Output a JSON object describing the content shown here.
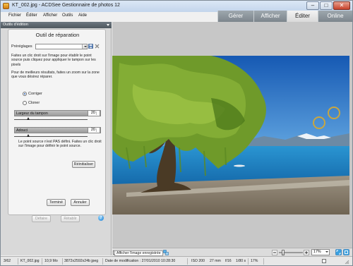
{
  "window": {
    "title": "KT_002.jpg - ACDSee Gestionnaire de photos 12",
    "min_glyph": "–",
    "max_glyph": "□",
    "close_glyph": "✕"
  },
  "menu": [
    "Fichier",
    "Éditer",
    "Afficher",
    "Outils",
    "Aide"
  ],
  "mode_tabs": {
    "manage": "Gérer",
    "view": "Afficher",
    "edit": "Éditer",
    "online": "Online"
  },
  "panel": {
    "header": "Outils d'édition",
    "tool_title": "Outil de réparation",
    "presets_label": "Préréglages",
    "presets_value": "",
    "intro_text": "Faites un clic droit sur l'image pour établir le point source puis cliquez pour appliquer le tampon sur les pixels",
    "zoom_text": "Pour de meilleurs résultats, faites un zoom sur la zone que vous désirez réparer.",
    "mode_correct": "Corriger",
    "mode_clone": "Cloner",
    "selected_mode": "Corriger",
    "brush_width_label": "Largeur du tampon",
    "brush_width_value": "20",
    "brush_width_level": 0.2,
    "softness_label": "Adouci",
    "softness_value": "20",
    "softness_level": 0.2,
    "source_note": "Le point source n'est PAS défini. Faites un clic droit sur l'image pour définir le point source.",
    "reset_button": "Réinitialiser",
    "done_button": "Terminé",
    "cancel_button": "Annuler",
    "undo_button": "Défaire",
    "redo_button": "Rétablir",
    "help_glyph": "?"
  },
  "viewbar": {
    "show_saved_label": "Afficher l'image enregistrée",
    "zoom_value": "17%"
  },
  "status": {
    "index": "3/62",
    "filename": "KT_002.jpg",
    "filesize": "10,9 Mo",
    "dimensions": "3872x2592x24b jpeg",
    "modified": "Date de modification : 27/01/2010 10:28:30",
    "iso": "ISO 200",
    "focal": "27 mm",
    "aperture": "f/16",
    "shutter": "1/80 s",
    "zoom": "17%"
  },
  "colors": {
    "mode_tab_bg": "#8a939a",
    "active_tab_bg": "#e8e8e8",
    "panel_header_bg": "#5c656c",
    "sky": "#1f6fc0",
    "lake": "#1e88c9",
    "foliage": "#6f9a2a",
    "ring": "#c9a640"
  }
}
